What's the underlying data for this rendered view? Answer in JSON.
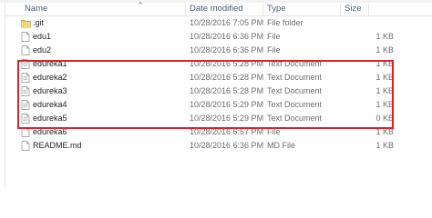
{
  "columns": {
    "name": "Name",
    "date": "Date modified",
    "type": "Type",
    "size": "Size",
    "sort_indicator": "^"
  },
  "files": [
    {
      "name": ".git",
      "date": "10/28/2016 7:05 PM",
      "type": "File folder",
      "size": "",
      "icon": "folder-icon"
    },
    {
      "name": "edu1",
      "date": "10/28/2016 6:36 PM",
      "type": "File",
      "size": "1 KB",
      "icon": "file-icon"
    },
    {
      "name": "edu2",
      "date": "10/28/2016 6:36 PM",
      "type": "File",
      "size": "1 KB",
      "icon": "file-icon"
    },
    {
      "name": "edureka1",
      "date": "10/28/2016 5:28 PM",
      "type": "Text Document",
      "size": "1 KB",
      "icon": "text-document-icon"
    },
    {
      "name": "edureka2",
      "date": "10/28/2016 5:28 PM",
      "type": "Text Document",
      "size": "1 KB",
      "icon": "text-document-icon"
    },
    {
      "name": "edureka3",
      "date": "10/28/2016 5:28 PM",
      "type": "Text Document",
      "size": "1 KB",
      "icon": "text-document-icon"
    },
    {
      "name": "edureka4",
      "date": "10/28/2016 5:29 PM",
      "type": "Text Document",
      "size": "1 KB",
      "icon": "text-document-icon"
    },
    {
      "name": "edureka5",
      "date": "10/28/2016 5:29 PM",
      "type": "Text Document",
      "size": "0 KB",
      "icon": "text-document-icon"
    },
    {
      "name": "edureka6",
      "date": "10/28/2016 6:57 PM",
      "type": "File",
      "size": "1 KB",
      "icon": "file-icon"
    },
    {
      "name": "README.md",
      "date": "10/28/2016 6:36 PM",
      "type": "MD File",
      "size": "1 KB",
      "icon": "md-file-icon"
    }
  ],
  "colors": {
    "highlight": "#d9232d",
    "header_text": "#4c607a",
    "folder": "#e8c25a"
  }
}
